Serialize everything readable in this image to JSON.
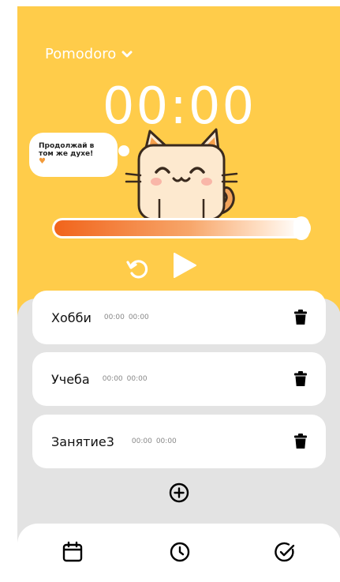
{
  "header": {
    "mode_label": "Pomodoro",
    "mode_icon": "chevron-down-icon"
  },
  "timer": {
    "display": "00:00"
  },
  "mascot": {
    "speech_line1": "Продолжай в",
    "speech_line2": "том же духе!",
    "speech_emoji": "♥"
  },
  "progress": {
    "fraction": 0.97
  },
  "controls": {
    "reset_icon": "reset-icon",
    "play_icon": "play-icon"
  },
  "tasks": [
    {
      "name": "Хобби",
      "time1": "00:00",
      "time2": "00:00"
    },
    {
      "name": "Учеба",
      "time1": "00:00",
      "time2": "00:00"
    },
    {
      "name": "Занятие3",
      "time1": "00:00",
      "time2": "00:00"
    }
  ],
  "add_icon": "plus-circle-icon",
  "nav": [
    {
      "icon": "calendar-icon"
    },
    {
      "icon": "clock-icon"
    },
    {
      "icon": "check-circle-icon"
    }
  ],
  "colors": {
    "accent_yellow": "#ffcc4a",
    "progress_orange": "#f1641b",
    "background_grey": "#e3e3e3"
  }
}
